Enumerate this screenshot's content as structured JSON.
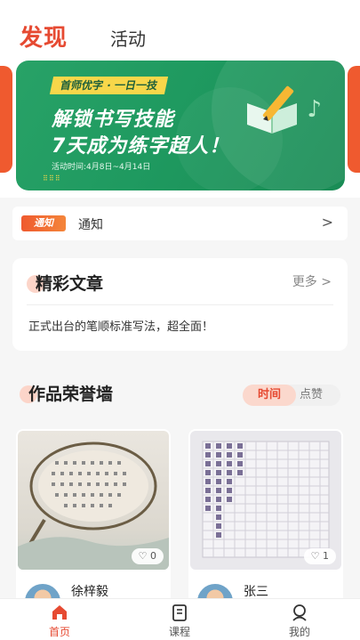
{
  "top_tabs": {
    "discover": "发现",
    "activity": "活动"
  },
  "banner": {
    "tag": "首师优字 · 一日一技",
    "line1": "解锁书写技能",
    "line2": "7天成为练字超人！",
    "time": "活动时间:4月8日~4月14日"
  },
  "notice": {
    "badge": "通知",
    "text": "通知",
    "arrow": ">"
  },
  "articles": {
    "title": "精彩文章",
    "more": "更多 >",
    "items": [
      "正式出台的笔顺标准写法，超全面！"
    ]
  },
  "works": {
    "title": "作品荣誉墙",
    "sort_active": "时间",
    "sort_other": "点赞",
    "cards": [
      {
        "likes": "0",
        "author": "徐梓毅"
      },
      {
        "likes": "1",
        "author": "张三"
      }
    ]
  },
  "bottom_nav": {
    "home": "首页",
    "course": "课程",
    "mine": "我的"
  },
  "colors": {
    "accent": "#e64a32",
    "banner": "#1f9a60"
  },
  "icons": {
    "home": "home-icon",
    "course": "course-book-icon",
    "mine": "user-icon",
    "like": "heart-icon",
    "notice_arrow": "chevron-right-icon"
  }
}
